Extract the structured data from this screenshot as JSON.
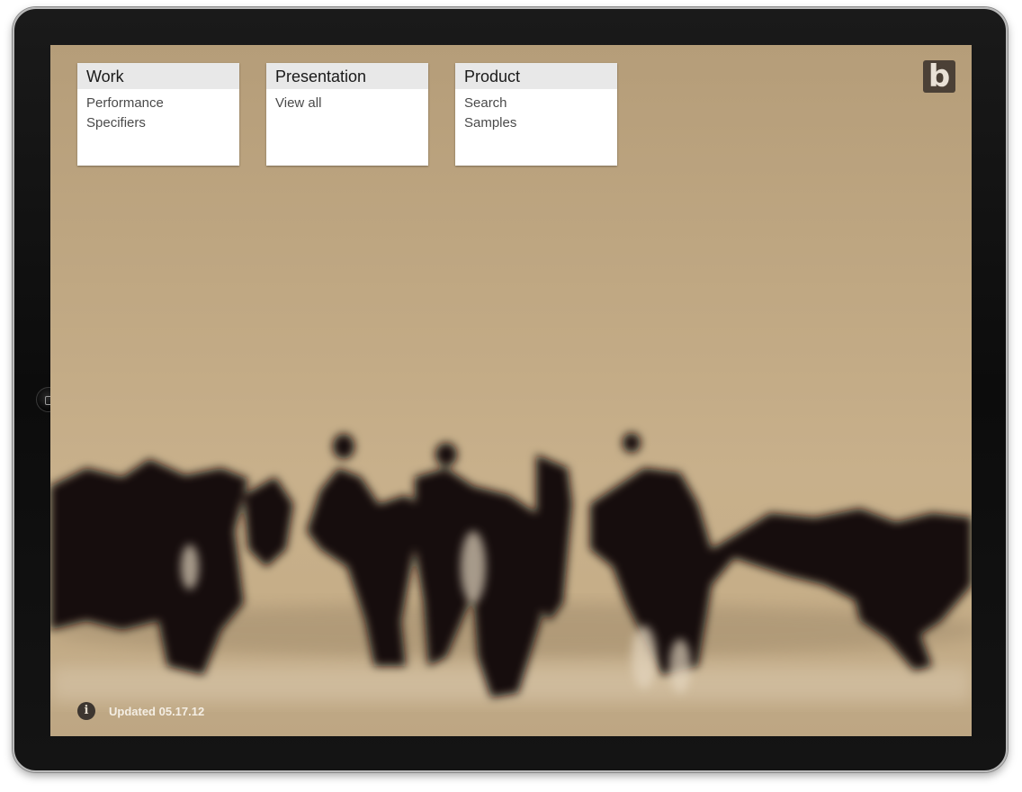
{
  "menus": [
    {
      "title": "Work",
      "links": [
        "Performance",
        "Specifiers"
      ]
    },
    {
      "title": "Presentation",
      "links": [
        "View all"
      ]
    },
    {
      "title": "Product",
      "links": [
        "Search",
        "Samples"
      ]
    }
  ],
  "logo": {
    "letter": "b",
    "icon": "brand-logo-b"
  },
  "footer": {
    "info_icon": "info-icon",
    "info_glyph": "i",
    "updated": "Updated 05.17.12"
  },
  "colors": {
    "background": "#c1a984",
    "silhouettes": "#120e0b",
    "card_header": "#e8e8e8",
    "logo_bg": "#4b4036"
  }
}
